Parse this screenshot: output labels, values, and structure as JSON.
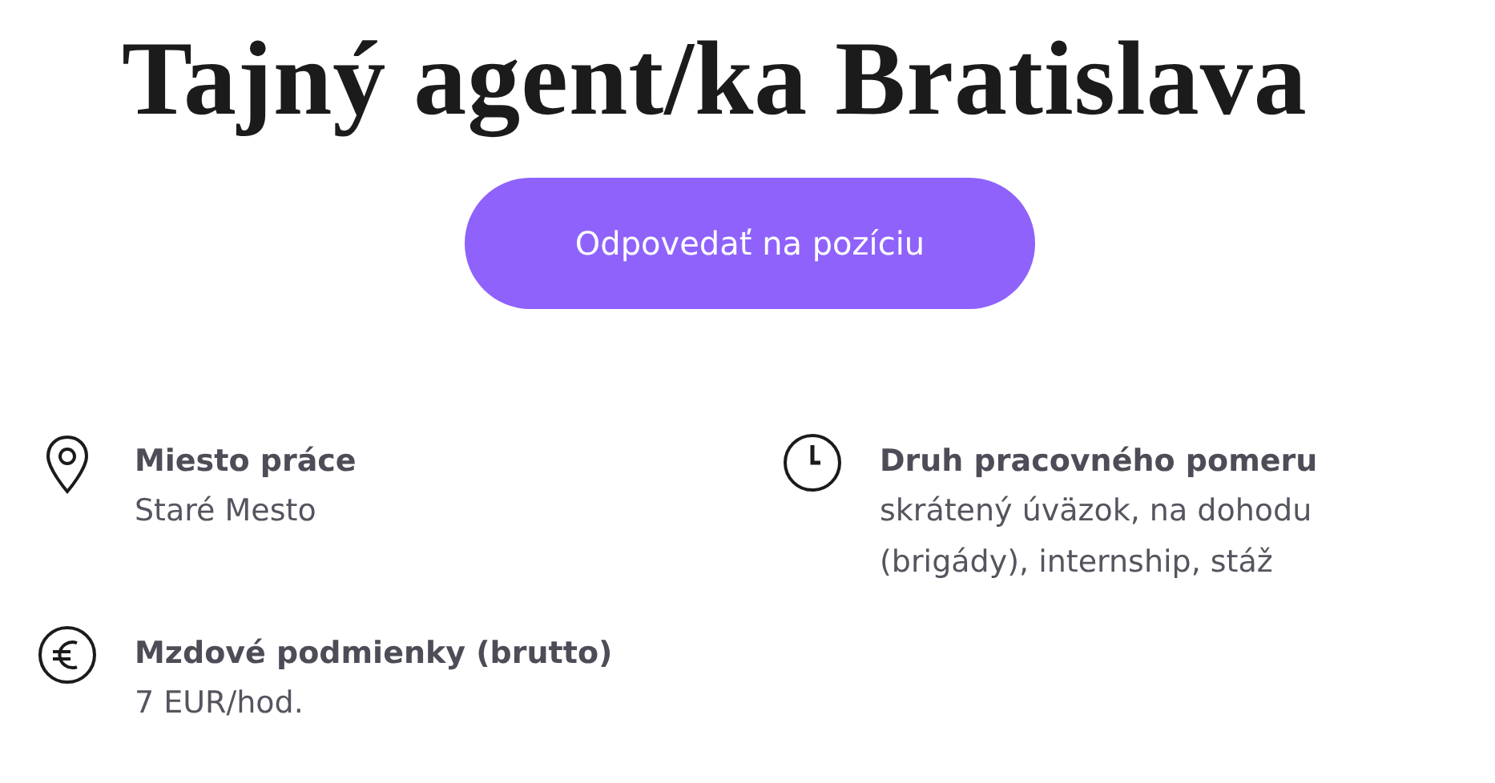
{
  "title": "Tajný agent/ka Bratislava",
  "apply_button": "Odpovedať na pozíciu",
  "details": [
    {
      "kind": "location",
      "label": "Miesto práce",
      "value": "Staré Mesto"
    },
    {
      "kind": "clock",
      "label": "Druh pracovného pomeru",
      "value": "skrátený úväzok, na dohodu (brigády), internship, stáž"
    },
    {
      "kind": "euro",
      "label": "Mzdové podmienky (brutto)",
      "value": "7 EUR/hod."
    }
  ]
}
